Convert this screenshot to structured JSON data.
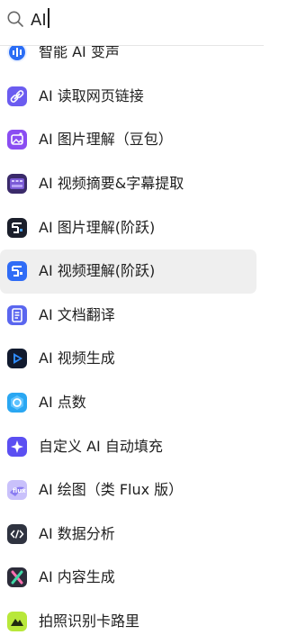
{
  "search": {
    "value": "AI",
    "icon": "search-icon"
  },
  "items": [
    {
      "label": "智能 AI 变声",
      "icon": "voice-wave-icon",
      "color": "#2a6df5"
    },
    {
      "label": "AI 读取网页链接",
      "icon": "link-icon",
      "color": "#6b5cf0"
    },
    {
      "label": "AI 图片理解（豆包）",
      "icon": "image-sparkle-icon",
      "color": "#8a4df2"
    },
    {
      "label": "AI 视频摘要&字幕提取",
      "icon": "film-icon",
      "color": "#5b3aa8"
    },
    {
      "label": "AI 图片理解(阶跃)",
      "icon": "stepfun-icon",
      "color": "#1b1f2b"
    },
    {
      "label": "AI 视频理解(阶跃)",
      "icon": "stepfun-blue-icon",
      "color": "#2f6cf6"
    },
    {
      "label": "AI 文档翻译",
      "icon": "document-icon",
      "color": "#5a66ef"
    },
    {
      "label": "AI 视频生成",
      "icon": "play-icon",
      "color": "#111a2e"
    },
    {
      "label": "AI 点数",
      "icon": "coin-icon",
      "color": "#2aa7f2"
    },
    {
      "label": "自定义 AI 自动填充",
      "icon": "sparkle-icon",
      "color": "#5b4ff2"
    },
    {
      "label": "AI 绘图（类 Flux 版）",
      "icon": "flux-icon",
      "color": "#8a7cf2"
    },
    {
      "label": "AI 数据分析",
      "icon": "code-icon",
      "color": "#2f3340"
    },
    {
      "label": "AI 内容生成",
      "icon": "x-logo-icon",
      "color": "#2c2c3a"
    },
    {
      "label": "拍照识别卡路里",
      "icon": "mountain-icon",
      "color": "#b8e83a"
    }
  ],
  "active_index": 5
}
